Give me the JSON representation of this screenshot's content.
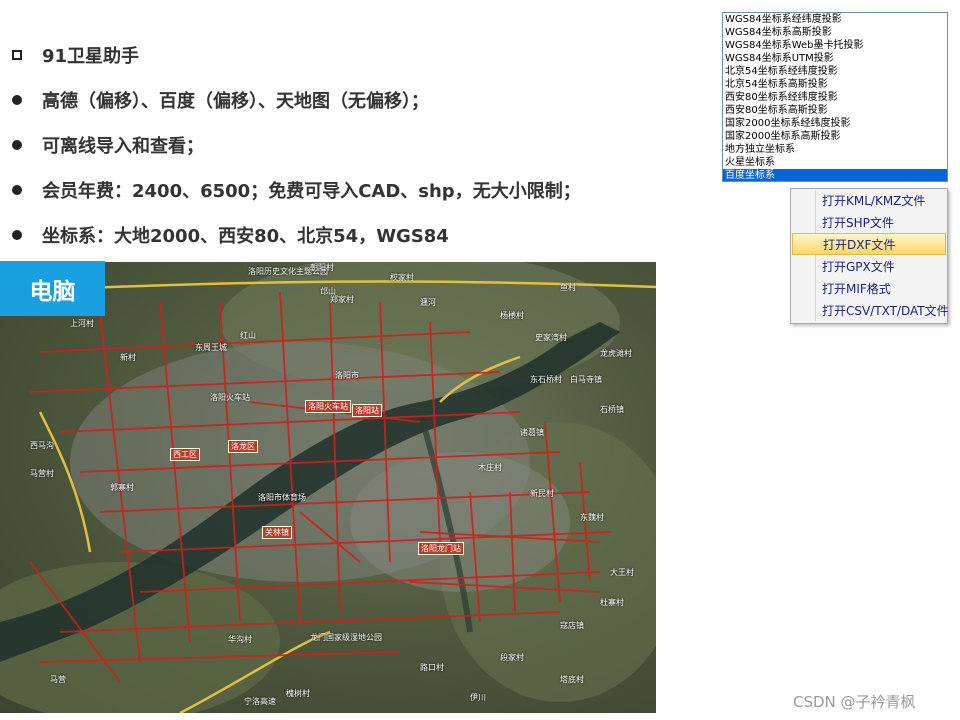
{
  "bullets": [
    {
      "marker": "square-icon",
      "text": "91卫星助手"
    },
    {
      "marker": "dot-icon",
      "text": "高德（偏移）、百度（偏移）、天地图（无偏移）；"
    },
    {
      "marker": "dot-icon",
      "text": "可离线导入和查看；"
    },
    {
      "marker": "dot-icon",
      "text": "会员年费：2400、6500；免费可导入CAD、shp，无大小限制；"
    },
    {
      "marker": "dot-icon",
      "text": "坐标系：大地2000、西安80、北京54，WGS84"
    }
  ],
  "pc_label": "电脑",
  "coord_list": {
    "items": [
      "WGS84坐标系经纬度投影",
      "WGS84坐标系高斯投影",
      "WGS84坐标系Web墨卡托投影",
      "WGS84坐标系UTM投影",
      "北京54坐标系经纬度投影",
      "北京54坐标系高斯投影",
      "西安80坐标系经纬度投影",
      "西安80坐标系高斯投影",
      "国家2000坐标系经纬度投影",
      "国家2000坐标系高斯投影",
      "地方独立坐标系",
      "火星坐标系",
      "百度坐标系"
    ],
    "selected": "百度坐标系"
  },
  "context_menu": {
    "items": [
      "打开KML/KMZ文件",
      "打开SHP文件",
      "打开DXF文件",
      "打开GPX文件",
      "打开MIF格式",
      "打开CSV/TXT/DAT文件"
    ],
    "highlighted": "打开DXF文件"
  },
  "map": {
    "labels": [
      "洛阳历史文化主题公园",
      "朝阳村",
      "权家村",
      "邙山",
      "瀍河",
      "鱼村",
      "郑家村",
      "杨楼村",
      "红山",
      "东周王城",
      "上河村",
      "新村",
      "洛阳火车站",
      "洛阳市",
      "史家湾村",
      "白马寺镇",
      "龙虎滩村",
      "东石桥村",
      "石桥镇",
      "诸葛镇",
      "西马沟",
      "马营村",
      "郭寨村",
      "木庄村",
      "洛阳市体育场",
      "新民村",
      "大王村",
      "杜寨村",
      "龙门国家级湿地公园",
      "寇店镇",
      "华沟村",
      "马营",
      "槐树村",
      "宁洛高速",
      "伊川",
      "路口村",
      "塔底村",
      "段家村",
      "东魏村"
    ],
    "highlights": [
      "洛阳火车站",
      "洛阳站",
      "西工区",
      "洛龙区",
      "关林镇",
      "洛阳龙门站"
    ]
  },
  "watermark": "CSDN @子衿青枫"
}
